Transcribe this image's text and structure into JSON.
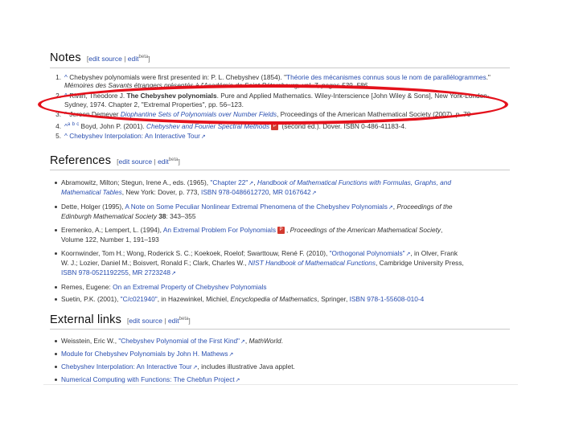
{
  "colors": {
    "link": "#2a4fb0",
    "annotation": "#e4111b",
    "text": "#222222",
    "rule": "#c9c9c9"
  },
  "edit_links": {
    "open": "[",
    "sep1": " | ",
    "close": "]",
    "edit_source": "edit source",
    "edit": "edit",
    "beta": "beta"
  },
  "notes": {
    "title": "Notes",
    "items": [
      {
        "num": "1.",
        "caret": "^",
        "l1_a": "Chebyshev polynomials were first presented in: P. L. Chebyshev (1854). \"",
        "l1_b": "Théorie des mécanismes connus sous le nom de parallélogrammes",
        "l1_c": ".\"",
        "l2": "Mémoires des Savants étrangers présentés à l'Académie de Saint-Pétersbourg, vol. 7, pages 539–586."
      },
      {
        "num": "2.",
        "caret": "^",
        "l1_a": "Rivlin, Theodore J. ",
        "l1_b": "The Chebyshev polynomials",
        "l1_c": ". Pure and Applied Mathematics. Wiley-Interscience [John Wiley & Sons], New York-London-",
        "l2": "Sydney, 1974. Chapter 2, \"Extremal Properties\", pp. 56–123."
      },
      {
        "num": "3.",
        "caret": "^",
        "l1_a": "Jeroen Demeyer ",
        "l1_b": "Diophantine Sets of Polynomials over Number Fields",
        "l1_c": ", Proceedings of the American Mathematical Society (2007), p. 70"
      },
      {
        "num": "4.",
        "caret": "^",
        "backlinks": [
          "a",
          "b",
          "c"
        ],
        "l1_a": "Boyd, John P. (2001). ",
        "l1_b": "Chebyshev and Fourier Spectral Methods",
        "l1_c": " (second ed.). Dover. ISBN 0-486-41183-4."
      },
      {
        "num": "5.",
        "caret": "^",
        "l1_b": "Chebyshev Interpolation: An Interactive Tour",
        "ext": "↗"
      }
    ]
  },
  "references": {
    "title": "References",
    "items": [
      {
        "l1": [
          "Abramowitz, Milton; Stegun, Irene A., eds. (1965), ",
          "\"Chapter 22\"",
          ", ",
          "Handbook of Mathematical Functions with Formulas, Graphs, and"
        ],
        "l2": [
          "Mathematical Tables",
          ", New York: Dover, p. 773, ",
          "ISBN 978-0486612720",
          ", ",
          "MR 0167642"
        ]
      },
      {
        "l1": [
          "Dette, Holger (1995), ",
          "A Note on Some Peculiar Nonlinear Extremal Phenomena of the Chebyshev Polynomials",
          ", ",
          "Proceedings of the"
        ],
        "l2": [
          "Edinburgh Mathematical Society",
          " 38",
          ": 343–355"
        ]
      },
      {
        "l1": [
          "Eremenko, A.; Lempert, L. (1994), ",
          "An Extremal Problem For Polynomials",
          ", ",
          "Proceedings of the American Mathematical Society",
          ","
        ],
        "l2": [
          "Volume 122, Number 1, 191–193"
        ]
      },
      {
        "l1": [
          "Koornwinder, Tom H.; Wong, Roderick S. C.; Koekoek, Roelof; Swarttouw, René F. (2010), ",
          "\"Orthogonal Polynomials\"",
          ", in Olver, Frank"
        ],
        "l2": [
          "W. J.; Lozier, Daniel M.; Boisvert, Ronald F.; Clark, Charles W., ",
          "NIST Handbook of Mathematical Functions",
          ", Cambridge University Press,"
        ],
        "l3": [
          "ISBN 978-0521192255",
          ", ",
          "MR 2723248"
        ]
      },
      {
        "l1": [
          "Remes, Eugene: ",
          "On an Extremal Property of Chebyshev Polynomials"
        ]
      },
      {
        "l1": [
          "Suetin, P.K. (2001), ",
          "\"C/c021940\"",
          ", in Hazewinkel, Michiel, ",
          "Encyclopedia of Mathematics",
          ", Springer, ",
          "ISBN 978-1-55608-010-4"
        ]
      }
    ]
  },
  "external_links": {
    "title": "External links",
    "items": [
      {
        "a": "Weisstein, Eric W., ",
        "b": "\"Chebyshev Polynomial of the First Kind\"",
        "c": ", ",
        "d": "MathWorld",
        "e": "."
      },
      {
        "b": "Module for Chebyshev Polynomials by John H. Mathews"
      },
      {
        "b": "Chebyshev Interpolation: An Interactive Tour",
        "c": ", includes illustrative Java applet."
      },
      {
        "b": "Numerical Computing with Functions: The Chebfun Project"
      }
    ]
  },
  "icons": {
    "external": "external-link-icon",
    "pdf": "pdf-icon",
    "bullet": "bullet-icon"
  }
}
